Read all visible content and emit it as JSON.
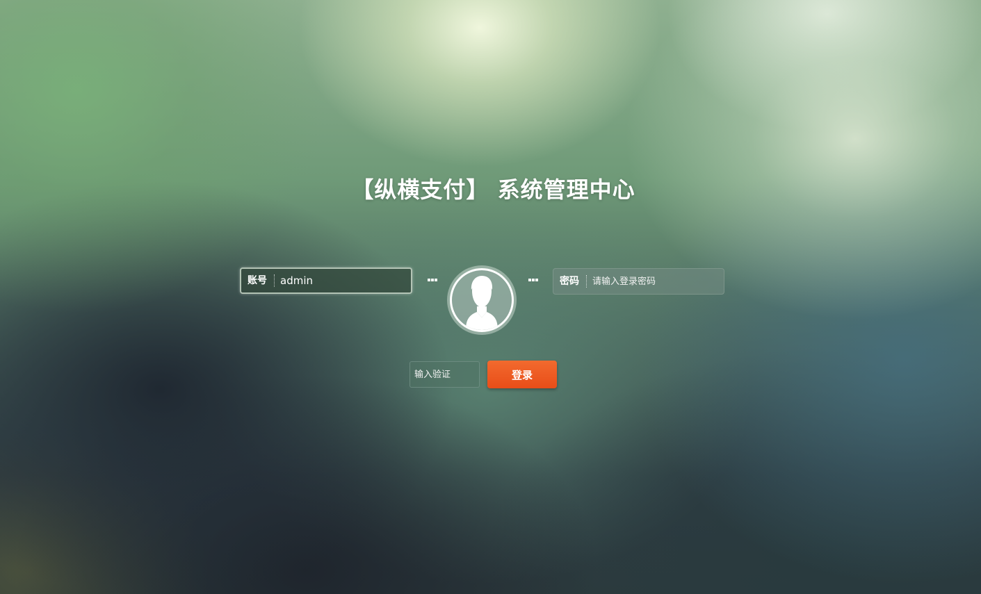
{
  "page": {
    "title": "【纵横支付】 系统管理中心"
  },
  "login": {
    "account": {
      "label": "账号",
      "value": "admin"
    },
    "password": {
      "label": "密码",
      "placeholder": "请输入登录密码"
    },
    "captcha": {
      "placeholder": "输入验证"
    },
    "submit_label": "登录",
    "avatar_icon": "user-avatar-icon"
  },
  "colors": {
    "accent": "#EE5A22",
    "text": "#FFFFFF"
  }
}
